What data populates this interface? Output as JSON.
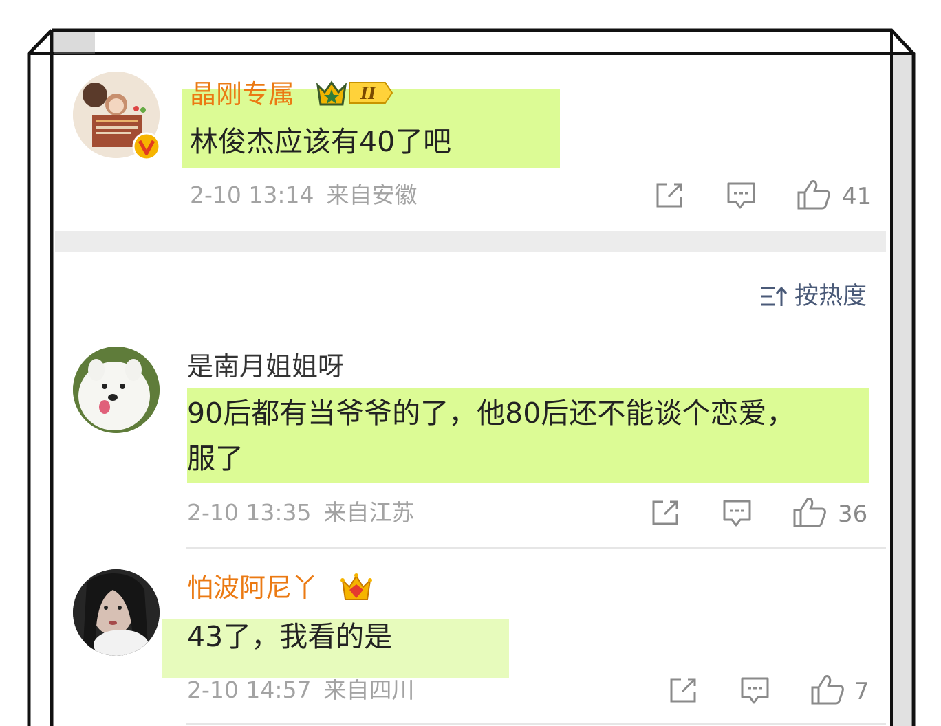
{
  "sort": {
    "label": "按热度"
  },
  "comments": [
    {
      "user": "晶刚专属",
      "text": "林俊杰应该有40了吧",
      "date": "2-10 13:14",
      "location": "来自安徽",
      "likes": "41",
      "vip_level": "II"
    },
    {
      "user": "是南月姐姐呀",
      "text": "90后都有当爷爷的了，他80后还不能谈个恋爱，服了",
      "date": "2-10 13:35",
      "location": "来自江苏",
      "likes": "36"
    },
    {
      "user": "怕波阿尼丫",
      "text": "43了，我看的是",
      "date": "2-10 14:57",
      "location": "来自四川",
      "likes": "7"
    }
  ],
  "colors": {
    "vip_username": "#eb7a13",
    "highlight": "#dcfb95",
    "meta": "#a3a3a3",
    "sort": "#4a5a78"
  },
  "icons": [
    "share-icon",
    "reply-icon",
    "like-icon",
    "sort-icon",
    "vip-crown-icon",
    "verified-v-icon"
  ]
}
